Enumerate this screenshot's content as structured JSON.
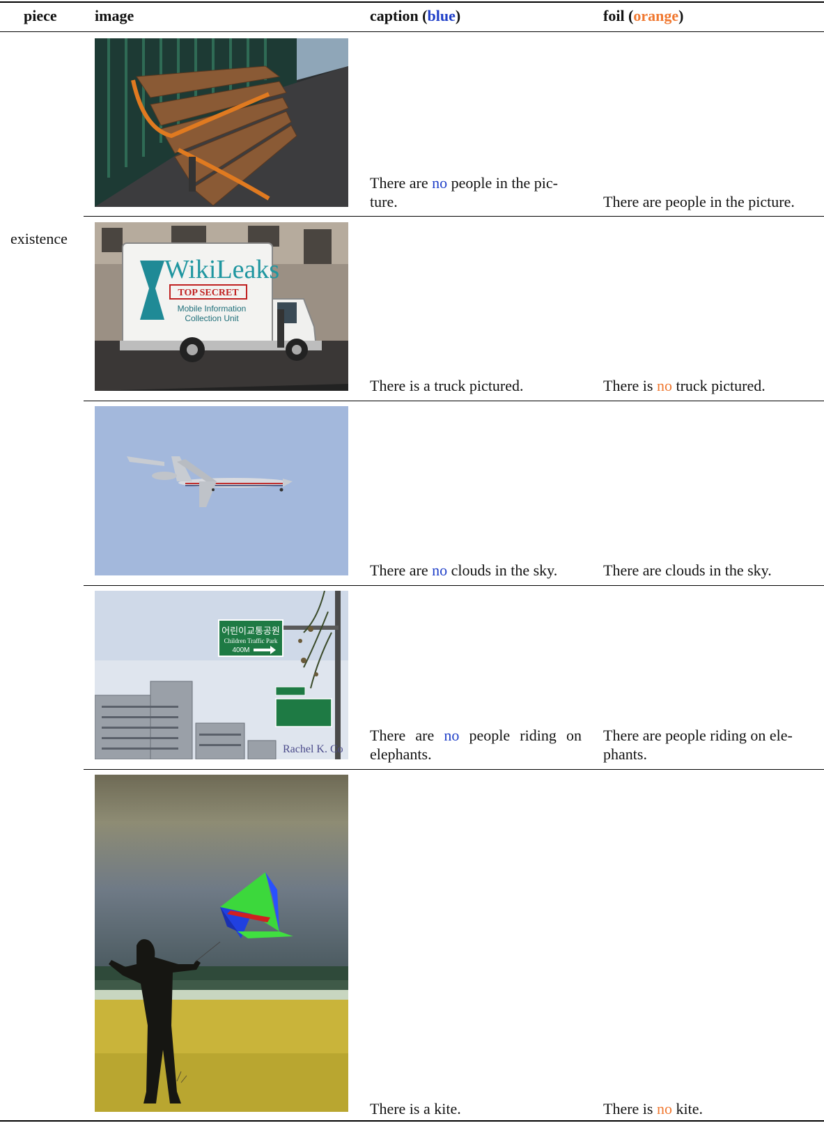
{
  "table": {
    "headers": {
      "piece": "piece",
      "image": "image",
      "caption_prefix": "caption (",
      "caption_color": "blue",
      "caption_suffix": ")",
      "foil_prefix": "foil (",
      "foil_color": "orange",
      "foil_suffix": ")"
    },
    "piece_label": "existence",
    "rows": [
      {
        "image_icon": "bench-photo",
        "caption": {
          "line1_a": "There are ",
          "line1_hl": "no",
          "line1_b": " people in the pic-",
          "line2": "ture."
        },
        "foil": {
          "text": "There are people in the picture."
        }
      },
      {
        "image_icon": "truck-photo",
        "image_text": {
          "brand": "WikiLeaks",
          "stamp": "TOP SECRET",
          "line1": "Mobile Information",
          "line2": "Collection Unit"
        },
        "caption": {
          "text": "There is a truck pictured."
        },
        "foil": {
          "a": "There is ",
          "hl": "no",
          "b": " truck pictured."
        }
      },
      {
        "image_icon": "airplane-photo",
        "caption": {
          "a": "There are ",
          "hl": "no",
          "b": " clouds in the sky."
        },
        "foil": {
          "text": "There are clouds in the sky."
        }
      },
      {
        "image_icon": "street-sign-photo",
        "image_text": {
          "sign_ko": "어린이교통공원",
          "sign_en": "Children Traffic Park",
          "sign_dist": "400M",
          "watermark": "Rachel K. Co"
        },
        "caption": {
          "line1_a": "There are ",
          "line1_hl": "no",
          "line1_b": " people riding on",
          "line2": "elephants."
        },
        "foil": {
          "line1": "There are people riding on ele-",
          "line2": "phants."
        }
      },
      {
        "image_icon": "kite-beach-photo",
        "caption": {
          "text": "There is a kite."
        },
        "foil": {
          "a": "There is ",
          "hl": "no",
          "b": " kite."
        }
      }
    ],
    "colors": {
      "caption_highlight": "#1f3fc8",
      "foil_highlight": "#f07830"
    }
  }
}
